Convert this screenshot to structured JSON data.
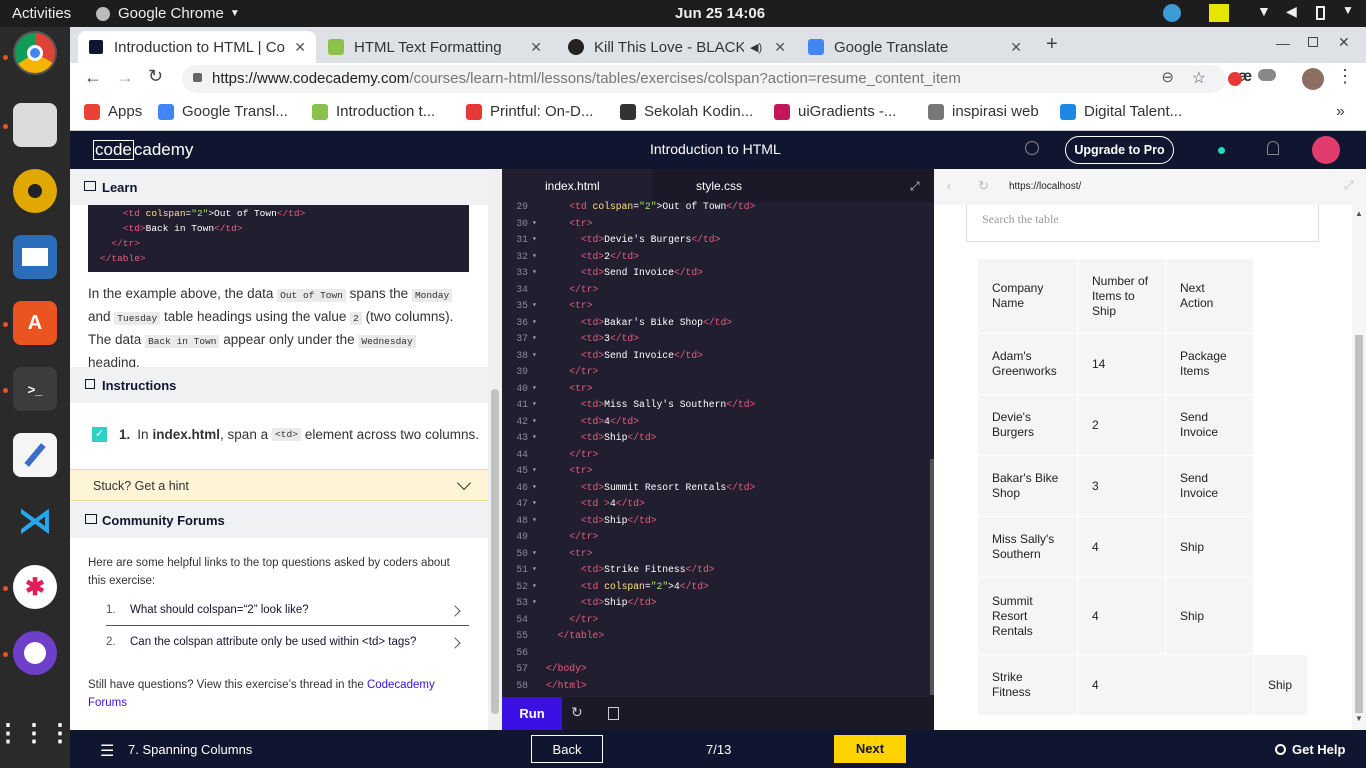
{
  "system": {
    "activities": "Activities",
    "app_name": "Google Chrome",
    "clock": "Jun 25  14:06"
  },
  "dock": [
    "chrome-icon",
    "files-icon",
    "rhythmbox-icon",
    "writer-icon",
    "software-icon",
    "terminal-icon",
    "text-editor-icon",
    "vscode-icon",
    "slack-icon",
    "github-icon",
    "app-grid-icon"
  ],
  "browser_tabs": [
    {
      "label": "Introduction to HTML | Co",
      "active": true,
      "color": "#10162f"
    },
    {
      "label": "HTML Text Formatting",
      "active": false,
      "color": "#8bc34a"
    },
    {
      "label": "Kill This Love - BLACKP",
      "active": false,
      "color": "#222222"
    },
    {
      "label": "Google Translate",
      "active": false,
      "color": "#4285f4"
    }
  ],
  "url": {
    "domain": "https://www.codecademy.com",
    "path": "/courses/learn-html/lessons/tables/exercises/colspan?action=resume_content_item"
  },
  "bookmarks": [
    {
      "label": "Apps",
      "color": "#ea4335"
    },
    {
      "label": "Google Transl...",
      "color": "#4285f4"
    },
    {
      "label": "Introduction t...",
      "color": "#8bc34a"
    },
    {
      "label": "Printful: On-D...",
      "color": "#e53935"
    },
    {
      "label": "Sekolah Kodin...",
      "color": "#333333"
    },
    {
      "label": "uiGradients -...",
      "color": "#c2185b"
    },
    {
      "label": "inspirasi web",
      "color": "#777777"
    },
    {
      "label": "Digital Talent...",
      "color": "#1e88e5"
    }
  ],
  "header": {
    "logo_code": "code",
    "logo_rest": "cademy",
    "course_title": "Introduction to HTML",
    "upgrade_label": "Upgrade to Pro"
  },
  "learn": {
    "title": "Learn",
    "snippet": [
      {
        "indent": "    ",
        "pre": "<td ",
        "attr": "colspan",
        "val": "\"2\"",
        "text": ">Out of Town",
        "post": "</td>"
      },
      {
        "indent": "    ",
        "pre": "<td>",
        "attr": "",
        "val": "",
        "text": "Back in Town",
        "post": "</td>"
      },
      {
        "indent": "  ",
        "pre": "</tr>",
        "attr": "",
        "val": "",
        "text": "",
        "post": ""
      },
      {
        "indent": "",
        "pre": "</table>",
        "attr": "",
        "val": "",
        "text": "",
        "post": ""
      }
    ],
    "p1": "In the example above, the data",
    "c1": "Out of Town",
    "p2": "spans the",
    "c2": "Monday",
    "p3": "and",
    "c3": "Tuesday",
    "p4": "table headings using the value",
    "c4": "2",
    "p5": "(two columns). The data",
    "c5": "Back in Town",
    "p6": "appear only under the",
    "c6": "Wednesday",
    "p7": "heading."
  },
  "instructions": {
    "title": "Instructions",
    "num": "1.",
    "t1": "In",
    "file": "index.html",
    "t2": ", span a",
    "code": "<td>",
    "t3": "element across two columns."
  },
  "hint": "Stuck? Get a hint",
  "forums": {
    "title": "Community Forums",
    "intro": "Here are some helpful links to the top questions asked by coders about this exercise:",
    "links": [
      {
        "num": "1.",
        "label": "What should colspan=“2” look like?"
      },
      {
        "num": "2.",
        "label": "Can the colspan attribute only be used within <td> tags?"
      }
    ],
    "outro": "Still have questions? View this exercise’s thread in the",
    "outro_link": "Codecademy Forums"
  },
  "editor": {
    "tabs": [
      "index.html",
      "style.css"
    ],
    "run": "Run",
    "lines": [
      {
        "n": "29",
        "f": "",
        "i": "    ",
        "p": "<td ",
        "a": "colspan",
        "v": "\"2\"",
        "t": ">Out of Town",
        "c": "</td>"
      },
      {
        "n": "30",
        "f": "▾",
        "i": "    ",
        "p": "<tr>",
        "a": "",
        "v": "",
        "t": "",
        "c": ""
      },
      {
        "n": "31",
        "f": "▾",
        "i": "      ",
        "p": "<td>",
        "a": "",
        "v": "",
        "t": "Devie's Burgers",
        "c": "</td>"
      },
      {
        "n": "32",
        "f": "▾",
        "i": "      ",
        "p": "<td>",
        "a": "",
        "v": "",
        "t": "2",
        "c": "</td>"
      },
      {
        "n": "33",
        "f": "▾",
        "i": "      ",
        "p": "<td>",
        "a": "",
        "v": "",
        "t": "Send Invoice",
        "c": "</td>"
      },
      {
        "n": "34",
        "f": "",
        "i": "    ",
        "p": "</tr>",
        "a": "",
        "v": "",
        "t": "",
        "c": ""
      },
      {
        "n": "35",
        "f": "▾",
        "i": "    ",
        "p": "<tr>",
        "a": "",
        "v": "",
        "t": "",
        "c": ""
      },
      {
        "n": "36",
        "f": "▾",
        "i": "      ",
        "p": "<td>",
        "a": "",
        "v": "",
        "t": "Bakar's Bike Shop",
        "c": "</td>"
      },
      {
        "n": "37",
        "f": "▾",
        "i": "      ",
        "p": "<td>",
        "a": "",
        "v": "",
        "t": "3",
        "c": "</td>"
      },
      {
        "n": "38",
        "f": "▾",
        "i": "      ",
        "p": "<td>",
        "a": "",
        "v": "",
        "t": "Send Invoice",
        "c": "</td>"
      },
      {
        "n": "39",
        "f": "",
        "i": "    ",
        "p": "</tr>",
        "a": "",
        "v": "",
        "t": "",
        "c": ""
      },
      {
        "n": "40",
        "f": "▾",
        "i": "    ",
        "p": "<tr>",
        "a": "",
        "v": "",
        "t": "",
        "c": ""
      },
      {
        "n": "41",
        "f": "▾",
        "i": "      ",
        "p": "<td>",
        "a": "",
        "v": "",
        "t": "Miss Sally's Southern",
        "c": "</td>"
      },
      {
        "n": "42",
        "f": "▾",
        "i": "      ",
        "p": "<td>",
        "a": "",
        "v": "",
        "t": "4",
        "c": "</td>"
      },
      {
        "n": "43",
        "f": "▾",
        "i": "      ",
        "p": "<td>",
        "a": "",
        "v": "",
        "t": "Ship",
        "c": "</td>"
      },
      {
        "n": "44",
        "f": "",
        "i": "    ",
        "p": "</tr>",
        "a": "",
        "v": "",
        "t": "",
        "c": ""
      },
      {
        "n": "45",
        "f": "▾",
        "i": "    ",
        "p": "<tr>",
        "a": "",
        "v": "",
        "t": "",
        "c": ""
      },
      {
        "n": "46",
        "f": "▾",
        "i": "      ",
        "p": "<td>",
        "a": "",
        "v": "",
        "t": "Summit Resort Rentals",
        "c": "</td>"
      },
      {
        "n": "47",
        "f": "▾",
        "i": "      ",
        "p": "<td >",
        "a": "",
        "v": "",
        "t": "4",
        "c": "</td>"
      },
      {
        "n": "48",
        "f": "▾",
        "i": "      ",
        "p": "<td>",
        "a": "",
        "v": "",
        "t": "Ship",
        "c": "</td>"
      },
      {
        "n": "49",
        "f": "",
        "i": "    ",
        "p": "</tr>",
        "a": "",
        "v": "",
        "t": "",
        "c": ""
      },
      {
        "n": "50",
        "f": "▾",
        "i": "    ",
        "p": "<tr>",
        "a": "",
        "v": "",
        "t": "",
        "c": ""
      },
      {
        "n": "51",
        "f": "▾",
        "i": "      ",
        "p": "<td>",
        "a": "",
        "v": "",
        "t": "Strike Fitness",
        "c": "</td>"
      },
      {
        "n": "52",
        "f": "▾",
        "i": "      ",
        "p": "<td ",
        "a": "colspan",
        "v": "\"2\"",
        "t": ">4",
        "c": "</td>"
      },
      {
        "n": "53",
        "f": "▾",
        "i": "      ",
        "p": "<td>",
        "a": "",
        "v": "",
        "t": "Ship",
        "c": "</td>"
      },
      {
        "n": "54",
        "f": "",
        "i": "    ",
        "p": "</tr>",
        "a": "",
        "v": "",
        "t": "",
        "c": ""
      },
      {
        "n": "55",
        "f": "",
        "i": "  ",
        "p": "</table>",
        "a": "",
        "v": "",
        "t": "",
        "c": ""
      },
      {
        "n": "56",
        "f": "",
        "i": "",
        "p": "",
        "a": "",
        "v": "",
        "t": "",
        "c": ""
      },
      {
        "n": "57",
        "f": "",
        "i": "",
        "p": "</body>",
        "a": "",
        "v": "",
        "t": "",
        "c": ""
      },
      {
        "n": "58",
        "f": "",
        "i": "",
        "p": "</html>",
        "a": "",
        "v": "",
        "t": "",
        "c": ""
      }
    ]
  },
  "preview": {
    "url": "https://localhost/",
    "search_placeholder": "Search the table",
    "headers": [
      "Company Name",
      "Number of Items to Ship",
      "Next Action"
    ],
    "rows": [
      {
        "name": "Adam's Greenworks",
        "qty": "14",
        "action": "Package Items",
        "span": false
      },
      {
        "name": "Devie's Burgers",
        "qty": "2",
        "action": "Send Invoice",
        "span": false
      },
      {
        "name": "Bakar's Bike Shop",
        "qty": "3",
        "action": "Send Invoice",
        "span": false
      },
      {
        "name": "Miss Sally's Southern",
        "qty": "4",
        "action": "Ship",
        "span": false
      },
      {
        "name": "Summit Resort Rentals",
        "qty": "4",
        "action": "Ship",
        "span": false
      },
      {
        "name": "Strike Fitness",
        "qty": "4",
        "action": "Ship",
        "span": true
      }
    ]
  },
  "footer": {
    "lesson": "7. Spanning Columns",
    "back": "Back",
    "progress": "7/13",
    "next": "Next",
    "help": "Get Help"
  }
}
